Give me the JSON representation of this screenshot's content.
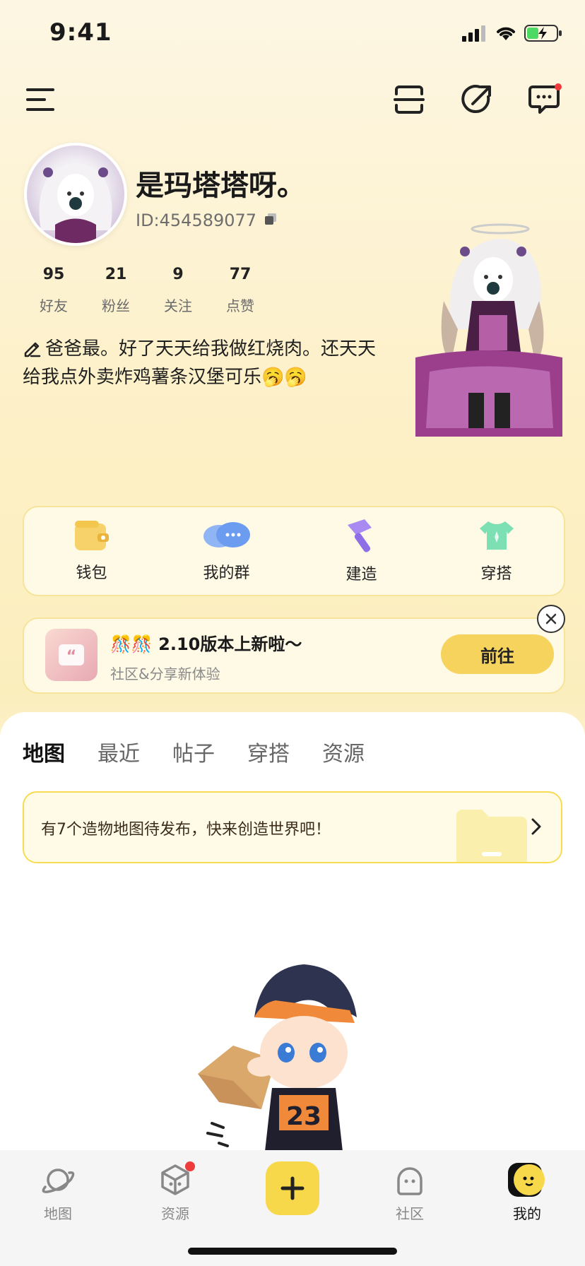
{
  "status_bar": {
    "time": "9:41"
  },
  "header": {
    "icons": [
      "menu-icon",
      "scan-icon",
      "share-icon",
      "message-icon"
    ]
  },
  "profile": {
    "nickname": "是玛塔塔呀。",
    "id_text": "ID:454589077",
    "stats": [
      {
        "value": "95",
        "label": "好友"
      },
      {
        "value": "21",
        "label": "粉丝"
      },
      {
        "value": "9",
        "label": "关注"
      },
      {
        "value": "77",
        "label": "点赞"
      }
    ],
    "bio": "爸爸最。好了天天给我做红烧肉。还天天给我点外卖炸鸡薯条汉堡可乐🥱🥱"
  },
  "quick_actions": [
    {
      "label": "钱包",
      "icon": "wallet-icon"
    },
    {
      "label": "我的群",
      "icon": "group-chat-icon"
    },
    {
      "label": "建造",
      "icon": "build-hammer-icon"
    },
    {
      "label": "穿搭",
      "icon": "outfit-icon"
    }
  ],
  "banner": {
    "title": "🎊🎊 2.10版本上新啦～",
    "subtitle": "社区&分享新体验",
    "button": "前往"
  },
  "tabs": [
    {
      "label": "地图",
      "active": true
    },
    {
      "label": "最近",
      "active": false
    },
    {
      "label": "帖子",
      "active": false
    },
    {
      "label": "穿搭",
      "active": false
    },
    {
      "label": "资源",
      "active": false
    }
  ],
  "draft_notice": {
    "text": "有7个造物地图待发布，快来创造世界吧！"
  },
  "bottom_nav": [
    {
      "label": "地图",
      "icon": "planet-icon",
      "active": false
    },
    {
      "label": "资源",
      "icon": "cube-icon",
      "active": false,
      "badge": true
    },
    {
      "label": "",
      "icon": "plus-icon",
      "active": false
    },
    {
      "label": "社区",
      "icon": "community-icon",
      "active": false
    },
    {
      "label": "我的",
      "icon": "me-avatar-icon",
      "active": true
    }
  ],
  "colors": {
    "accent_yellow": "#f6d35c",
    "badge_red": "#ee3b3b",
    "card_border": "#f6e49a"
  }
}
